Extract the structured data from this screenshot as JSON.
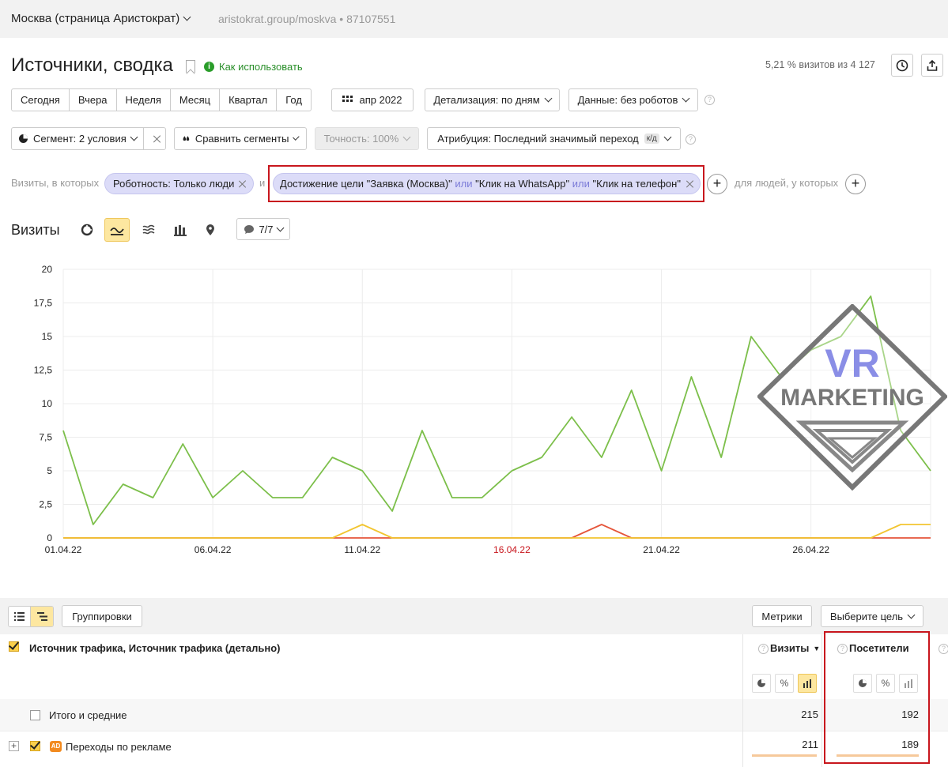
{
  "counter": {
    "name": "Москва (страница Аристократ)",
    "url": "aristokrat.group/moskva",
    "id": "87107551"
  },
  "page": {
    "title": "Источники, сводка",
    "howto": "Как использовать",
    "visits_share": "5,21 % визитов из 4 127"
  },
  "periods": [
    "Сегодня",
    "Вчера",
    "Неделя",
    "Месяц",
    "Квартал",
    "Год"
  ],
  "date_range": "апр 2022",
  "detail": "Детализация: по дням",
  "data_mode": "Данные: без роботов",
  "segment": {
    "label": "Сегмент: 2 условия",
    "compare": "Сравнить сегменты",
    "accuracy": "Точность: 100%",
    "attribution": "Атрибуция: Последний значимый переход",
    "attribution_badge": "к/д"
  },
  "filters": {
    "prefix": "Визиты, в которых",
    "chip1": "Роботность: Только люди",
    "and": "и",
    "goal_a": "Достижение цели \"Заявка (Москва)\"",
    "or1": "или",
    "goal_b": "\"Клик на WhatsApp\"",
    "or2": "или",
    "goal_c": "\"Клик на телефон\"",
    "people": "для людей, у которых"
  },
  "chart_section": {
    "title": "Визиты",
    "series_counter": "7/7"
  },
  "chart_data": {
    "type": "line",
    "x": [
      "01.04.22",
      "02.04.22",
      "03.04.22",
      "04.04.22",
      "05.04.22",
      "06.04.22",
      "07.04.22",
      "08.04.22",
      "09.04.22",
      "10.04.22",
      "11.04.22",
      "12.04.22",
      "13.04.22",
      "14.04.22",
      "15.04.22",
      "16.04.22",
      "17.04.22",
      "18.04.22",
      "19.04.22",
      "20.04.22",
      "21.04.22",
      "22.04.22",
      "23.04.22",
      "24.04.22",
      "25.04.22",
      "26.04.22",
      "27.04.22",
      "28.04.22",
      "29.04.22",
      "30.04.22"
    ],
    "x_tick_labels": [
      "01.04.22",
      "06.04.22",
      "11.04.22",
      "16.04.22",
      "21.04.22",
      "26.04.22"
    ],
    "highlight_tick": "16.04.22",
    "ylim": [
      0,
      20
    ],
    "y_ticks": [
      "0",
      "2,5",
      "5",
      "7,5",
      "10",
      "12,5",
      "15",
      "17,5",
      "20"
    ],
    "grid": true,
    "series": [
      {
        "color": "#7cbf4a",
        "values": [
          8,
          1,
          4,
          3,
          7,
          3,
          5,
          3,
          3,
          6,
          5,
          2,
          8,
          3,
          3,
          5,
          6,
          9,
          6,
          11,
          5,
          12,
          6,
          15,
          12,
          14,
          15,
          18,
          8,
          5
        ]
      },
      {
        "color": "#f2c530",
        "values": [
          0,
          0,
          0,
          0,
          0,
          0,
          0,
          0,
          0,
          0,
          1,
          0,
          0,
          0,
          0,
          0,
          0,
          0,
          0,
          0,
          0,
          0,
          0,
          0,
          0,
          0,
          0,
          0,
          1,
          1
        ]
      },
      {
        "color": "#e5553a",
        "values": [
          0,
          0,
          0,
          0,
          0,
          0,
          0,
          0,
          0,
          0,
          0,
          0,
          0,
          0,
          0,
          0,
          0,
          0,
          1,
          0,
          0,
          0,
          0,
          0,
          0,
          0,
          0,
          0,
          0,
          0
        ]
      }
    ]
  },
  "watermark": {
    "line1": "VR",
    "line2": "MARKETING"
  },
  "table": {
    "groupings": "Группировки",
    "metrics": "Метрики",
    "goal_select": "Выберите цель",
    "dimension": "Источник трафика, Источник трафика (детально)",
    "col_visits": "Визиты",
    "col_visitors": "Посетители",
    "rows": [
      {
        "label": "Итого и средние",
        "visits": "215",
        "visitors": "192"
      },
      {
        "label": "Переходы по рекламе",
        "badge": "AD",
        "visits": "211",
        "visitors": "189"
      }
    ]
  }
}
